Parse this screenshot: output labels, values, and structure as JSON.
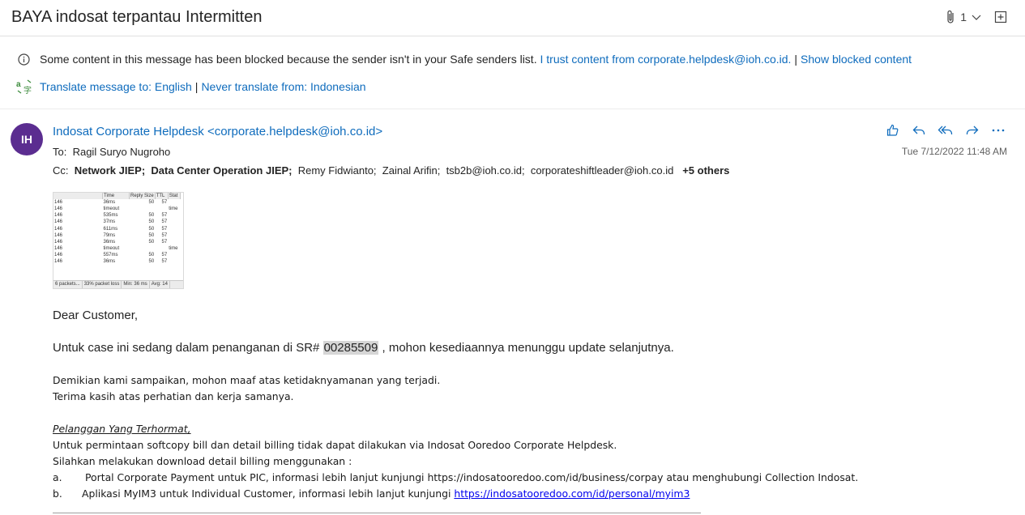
{
  "subject": "BAYA indosat terpantau Intermitten",
  "header": {
    "attachment_count": "1"
  },
  "notice": {
    "text": "Some content in this message has been blocked because the sender isn't in your Safe senders list.",
    "trust_link": "I trust content from corporate.helpdesk@ioh.co.id.",
    "separator": "|",
    "show_blocked": "Show blocked content"
  },
  "translate": {
    "translate_link": "Translate message to: English",
    "separator": "|",
    "never_link": "Never translate from: Indonesian"
  },
  "email": {
    "avatar_initials": "IH",
    "sender": "Indosat Corporate Helpdesk <corporate.helpdesk@ioh.co.id>",
    "to_label": "To:",
    "to": "Ragil Suryo Nugroho",
    "cc_label": "Cc:",
    "cc": [
      {
        "name": "Network JIEP;",
        "bold": true
      },
      {
        "name": "Data Center Operation JIEP;",
        "bold": true
      },
      {
        "name": "Remy Fidwianto;",
        "bold": false
      },
      {
        "name": "Zainal Arifin;",
        "bold": false
      },
      {
        "name": "tsb2b@ioh.co.id;",
        "bold": false
      },
      {
        "name": "corporateshiftleader@ioh.co.id",
        "bold": false
      }
    ],
    "others": "+5 others",
    "timestamp": "Tue 7/12/2022 11:48 AM"
  },
  "ping_image": {
    "headers": [
      "",
      "Time",
      "Reply Size",
      "TTL",
      "Stat"
    ],
    "rows": [
      [
        "146",
        "36ms",
        "50",
        "57",
        ""
      ],
      [
        "146",
        "timeout",
        "",
        "",
        "time"
      ],
      [
        "146",
        "535ms",
        "50",
        "57",
        ""
      ],
      [
        "146",
        "37ms",
        "50",
        "57",
        ""
      ],
      [
        "146",
        "611ms",
        "50",
        "57",
        ""
      ],
      [
        "146",
        "79ms",
        "50",
        "57",
        ""
      ],
      [
        "146",
        "36ms",
        "50",
        "57",
        ""
      ],
      [
        "146",
        "timeout",
        "",
        "",
        "time"
      ],
      [
        "146",
        "557ms",
        "50",
        "57",
        ""
      ],
      [
        "146",
        "36ms",
        "50",
        "57",
        ""
      ]
    ],
    "footer": [
      "6 packets...",
      "33% packet loss",
      "Min: 36 ms",
      "Avg: 14"
    ]
  },
  "body": {
    "greeting": "Dear Customer,",
    "line1_pre": "Untuk case ini sedang dalam penanganan di SR#",
    "sr_number": "00285509",
    "line1_post": ", mohon kesediaannya menunggu update selanjutnya.",
    "closing1": "Demikian kami sampaikan, mohon maaf atas ketidaknyamanan yang terjadi.",
    "closing2": "Terima kasih atas perhatian dan kerja samanya.",
    "footer_title": "Pelanggan Yang Terhormat,",
    "footer1": "Untuk permintaan softcopy bill dan detail billing tidak dapat dilakukan via Indosat Ooredoo Corporate Helpdesk.",
    "footer2": "Silahkan melakukan download detail billing menggunakan :",
    "item_a_label": "a.",
    "item_a_text": "Portal Corporate Payment untuk PIC, informasi lebih lanjut  kunjungi https://indosatooredoo.com/id/business/corpay atau menghubungi Collection Indosat.",
    "item_b_label": "b.",
    "item_b_text": "Aplikasi MyIM3 untuk Individual Customer, informasi lebih lanjut kunjungi",
    "item_b_link": "https://indosatooredoo.com/id/personal/myim3"
  }
}
